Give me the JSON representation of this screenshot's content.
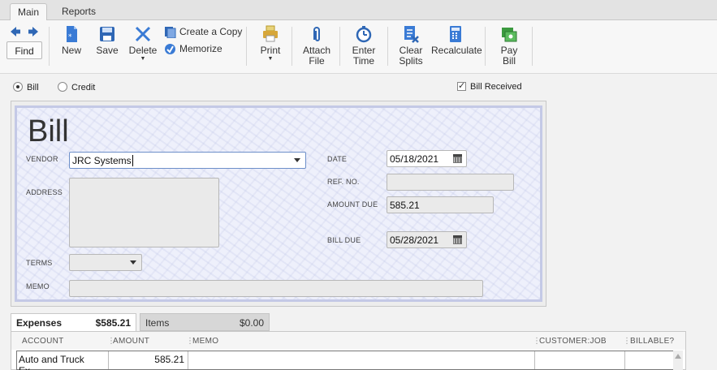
{
  "tabs": {
    "main": "Main",
    "reports": "Reports"
  },
  "toolbar": {
    "find": "Find",
    "new": "New",
    "save": "Save",
    "delete": "Delete",
    "create_copy": "Create a Copy",
    "memorize": "Memorize",
    "print": "Print",
    "attach_file": [
      "Attach",
      "File"
    ],
    "enter_time": [
      "Enter",
      "Time"
    ],
    "clear_splits": [
      "Clear",
      "Splits"
    ],
    "recalculate": "Recalculate",
    "pay_bill": [
      "Pay",
      "Bill"
    ]
  },
  "type_options": {
    "bill": "Bill",
    "credit": "Credit",
    "selected": "bill"
  },
  "bill_received": {
    "label": "Bill Received",
    "checked": true
  },
  "form": {
    "title": "Bill",
    "vendor_label": "VENDOR",
    "vendor_value": "JRC Systems",
    "address_label": "ADDRESS",
    "terms_label": "TERMS",
    "memo_label": "MEMO",
    "date_label": "DATE",
    "date_value": "05/18/2021",
    "ref_label": "REF. NO.",
    "ref_value": "",
    "amount_due_label": "AMOUNT DUE",
    "amount_due_value": "585.21",
    "bill_due_label": "BILL DUE",
    "bill_due_value": "05/28/2021"
  },
  "bottom_tabs": {
    "expenses_label": "Expenses",
    "expenses_amount": "$585.21",
    "items_label": "Items",
    "items_amount": "$0.00"
  },
  "table": {
    "headers": [
      "ACCOUNT",
      "AMOUNT",
      "MEMO",
      "CUSTOMER:JOB",
      "BILLABLE?"
    ],
    "rows": [
      {
        "account": "Auto and Truck Ex...",
        "amount": "585.21",
        "memo": "",
        "customer_job": "",
        "billable": ""
      }
    ]
  },
  "colors": {
    "accent": "#2f67b5",
    "form_bg": "#eef0fb",
    "form_border": "#c4c9e6"
  }
}
